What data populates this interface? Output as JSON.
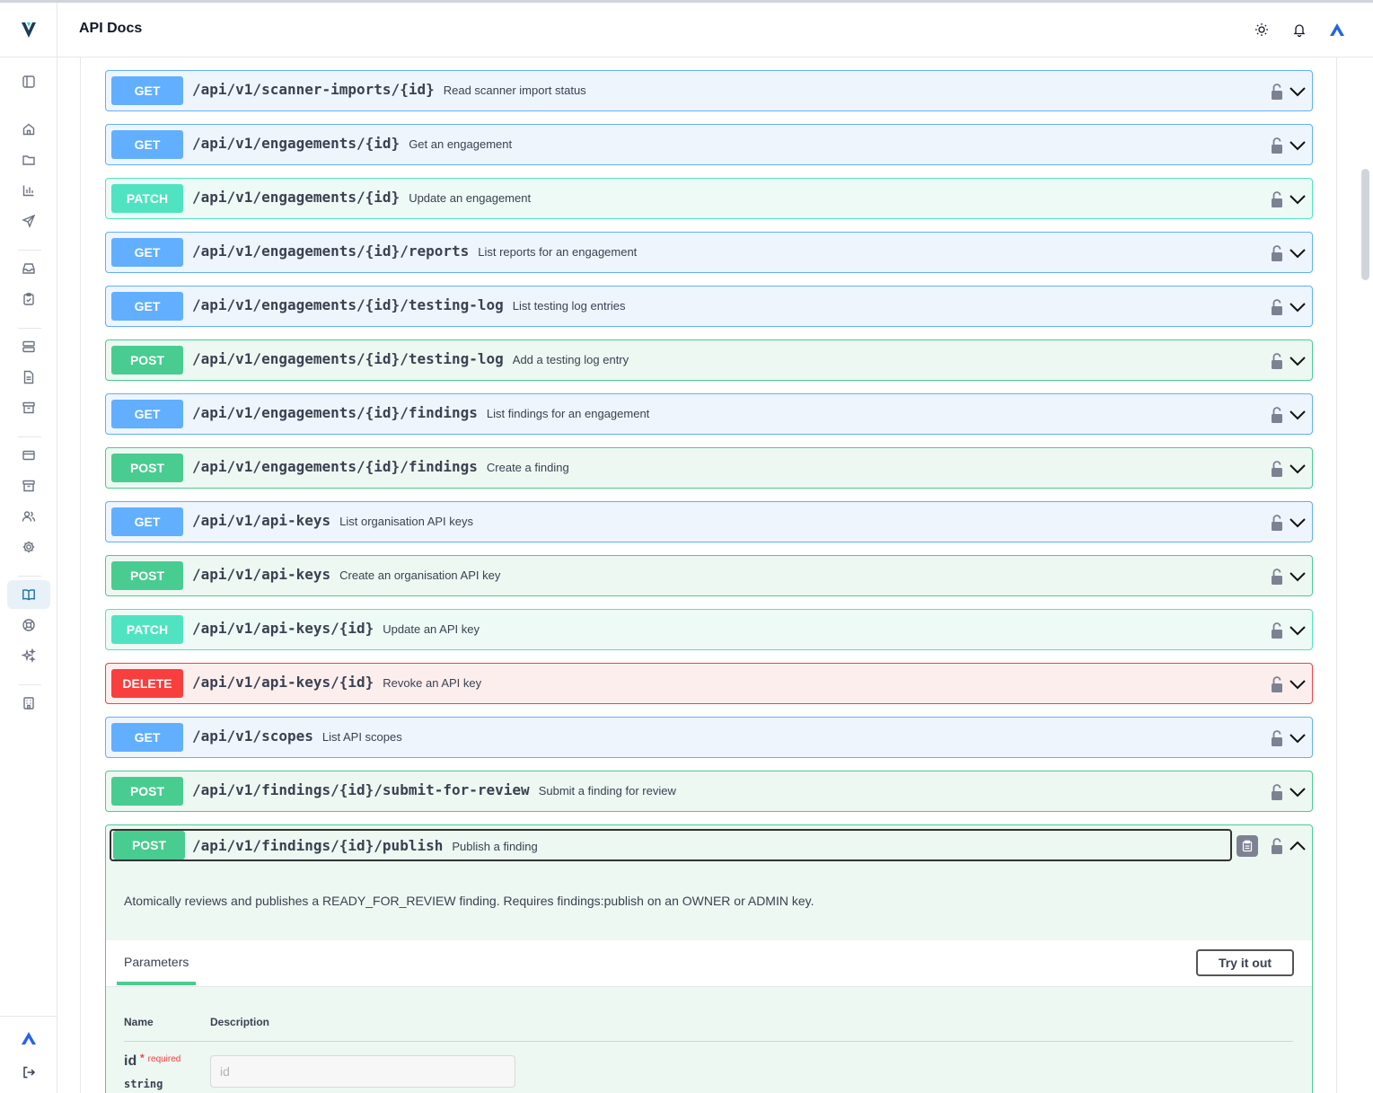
{
  "header": {
    "title": "API Docs"
  },
  "operations": [
    {
      "method": "GET",
      "path": "/api/v1/scanner-imports/{id}",
      "summary": "Read scanner import status"
    },
    {
      "method": "GET",
      "path": "/api/v1/engagements/{id}",
      "summary": "Get an engagement"
    },
    {
      "method": "PATCH",
      "path": "/api/v1/engagements/{id}",
      "summary": "Update an engagement"
    },
    {
      "method": "GET",
      "path": "/api/v1/engagements/{id}/reports",
      "summary": "List reports for an engagement"
    },
    {
      "method": "GET",
      "path": "/api/v1/engagements/{id}/testing-log",
      "summary": "List testing log entries"
    },
    {
      "method": "POST",
      "path": "/api/v1/engagements/{id}/testing-log",
      "summary": "Add a testing log entry"
    },
    {
      "method": "GET",
      "path": "/api/v1/engagements/{id}/findings",
      "summary": "List findings for an engagement"
    },
    {
      "method": "POST",
      "path": "/api/v1/engagements/{id}/findings",
      "summary": "Create a finding"
    },
    {
      "method": "GET",
      "path": "/api/v1/api-keys",
      "summary": "List organisation API keys"
    },
    {
      "method": "POST",
      "path": "/api/v1/api-keys",
      "summary": "Create an organisation API key"
    },
    {
      "method": "PATCH",
      "path": "/api/v1/api-keys/{id}",
      "summary": "Update an API key"
    },
    {
      "method": "DELETE",
      "path": "/api/v1/api-keys/{id}",
      "summary": "Revoke an API key"
    },
    {
      "method": "GET",
      "path": "/api/v1/scopes",
      "summary": "List API scopes"
    },
    {
      "method": "POST",
      "path": "/api/v1/findings/{id}/submit-for-review",
      "summary": "Submit a finding for review"
    }
  ],
  "expanded": {
    "method": "POST",
    "path": "/api/v1/findings/{id}/publish",
    "summary": "Publish a finding",
    "description": "Atomically reviews and publishes a READY_FOR_REVIEW finding. Requires findings:publish on an OWNER or ADMIN key.",
    "parameters_tab": "Parameters",
    "try_it_out": "Try it out",
    "col_name": "Name",
    "col_description": "Description",
    "param": {
      "name": "id",
      "required_mark": "*",
      "required_label": "required",
      "type": "string",
      "placeholder": "id"
    }
  },
  "colors": {
    "get": "#61affe",
    "post": "#49cc90",
    "patch": "#50e3c2",
    "delete": "#f93e3e",
    "brand": "#2563eb"
  },
  "sidebar": {
    "icons": [
      "sidebar-toggle-icon",
      "home-icon",
      "folder-icon",
      "bar-chart-icon",
      "send-icon",
      "inbox-icon",
      "clipboard-check-icon",
      "server-icon",
      "document-icon",
      "archive-icon",
      "credit-card-icon",
      "archive-box-icon",
      "users-icon",
      "gear-icon",
      "book-open-icon",
      "lifebuoy-icon",
      "sparkles-icon",
      "building-icon"
    ],
    "bottom_icons": [
      "brand-logo-icon",
      "logout-icon"
    ]
  },
  "header_icons": [
    "sun-icon",
    "bell-icon",
    "brand-logo-icon"
  ]
}
